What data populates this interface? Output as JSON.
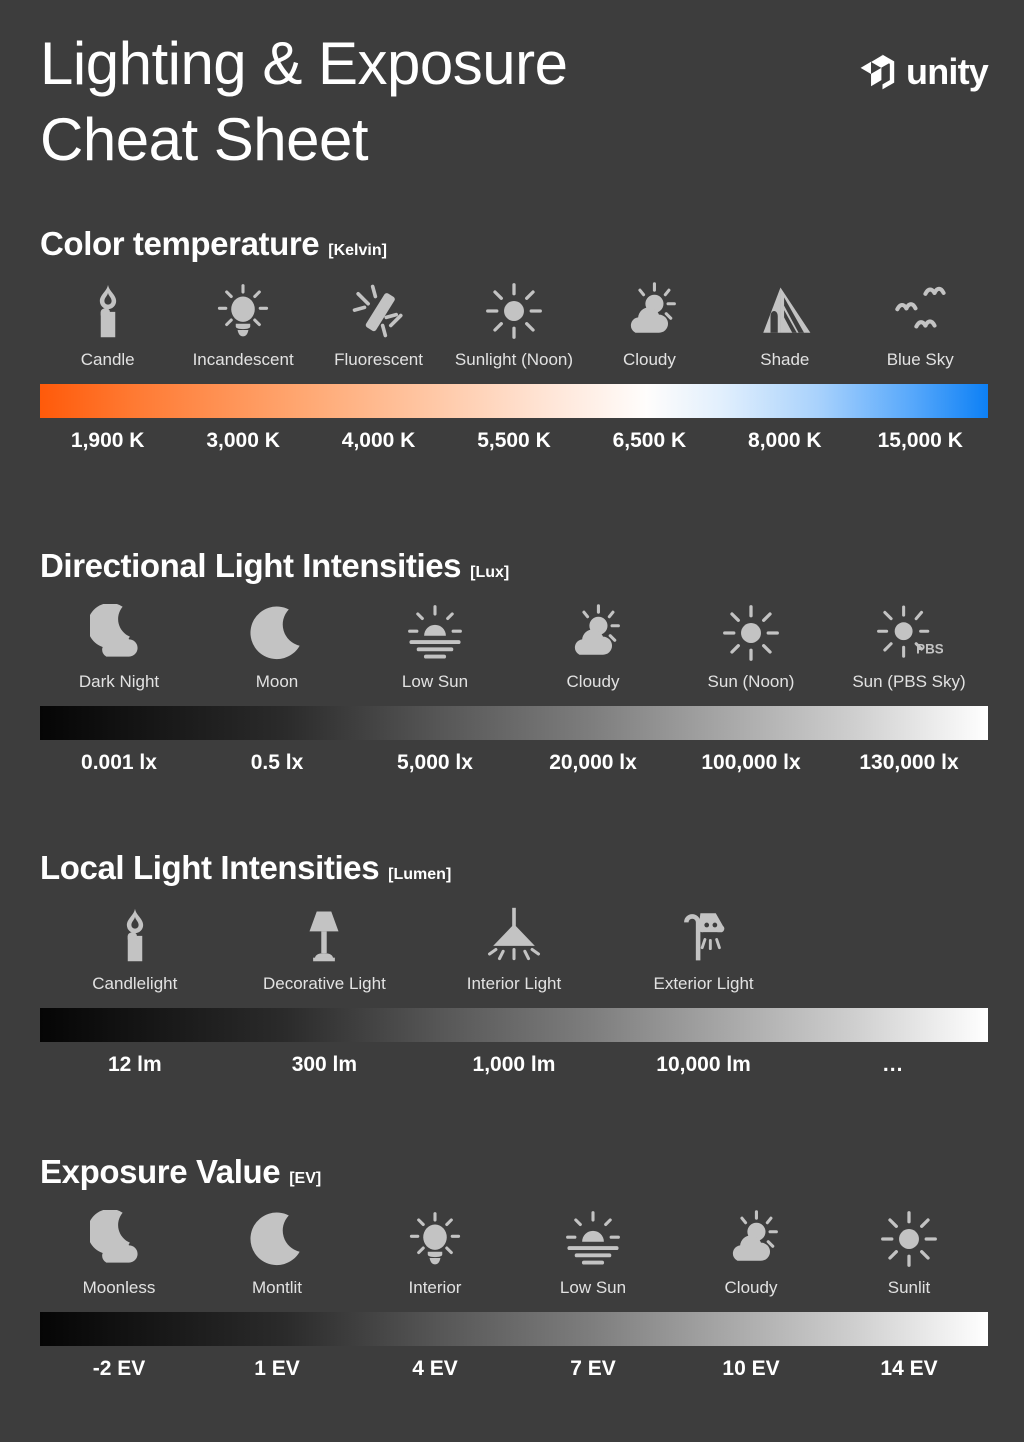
{
  "header": {
    "title": "Lighting & Exposure\nCheat Sheet",
    "brand": "unity",
    "logo_icon": "unity-cube-icon"
  },
  "colors": {
    "background": "#3d3d3d",
    "text": "#ffffff",
    "icon": "#c3c3c3",
    "kelvin_warm": "#ff5a0a",
    "kelvin_cool": "#0d80f5",
    "gray_dark": "#050505",
    "gray_light": "#ffffff"
  },
  "sections": [
    {
      "id": "color-temperature",
      "title": "Color temperature",
      "unit": "[Kelvin]",
      "bar_style": "kelvin",
      "items": [
        {
          "icon": "candle-icon",
          "label": "Candle",
          "value": "1,900 K"
        },
        {
          "icon": "incandescent-bulb-icon",
          "label": "Incandescent",
          "value": "3,000 K"
        },
        {
          "icon": "fluorescent-tube-icon",
          "label": "Fluorescent",
          "value": "4,000 K"
        },
        {
          "icon": "sun-icon",
          "label": "Sunlight (Noon)",
          "value": "5,500 K"
        },
        {
          "icon": "sun-cloud-icon",
          "label": "Cloudy",
          "value": "6,500 K"
        },
        {
          "icon": "shade-house-icon",
          "label": "Shade",
          "value": "8,000 K"
        },
        {
          "icon": "birds-sky-icon",
          "label": "Blue Sky",
          "value": "15,000 K"
        }
      ]
    },
    {
      "id": "directional-light-intensities",
      "title": "Directional Light Intensities",
      "unit": "[Lux]",
      "bar_style": "gray",
      "items": [
        {
          "icon": "moon-cloud-icon",
          "label": "Dark Night",
          "value": "0.001 lx"
        },
        {
          "icon": "moon-icon",
          "label": "Moon",
          "value": "0.5 lx"
        },
        {
          "icon": "low-sun-icon",
          "label": "Low Sun",
          "value": "5,000 lx"
        },
        {
          "icon": "sun-cloud-icon",
          "label": "Cloudy",
          "value": "20,000 lx"
        },
        {
          "icon": "sun-icon",
          "label": "Sun (Noon)",
          "value": "100,000 lx"
        },
        {
          "icon": "sun-pbs-icon",
          "label": "Sun (PBS Sky)",
          "value": "130,000 lx"
        }
      ]
    },
    {
      "id": "local-light-intensities",
      "title": "Local Light Intensities",
      "unit": "[Lumen]",
      "bar_style": "gray",
      "items": [
        {
          "icon": "candle-icon",
          "label": "Candlelight",
          "value": "12 lm"
        },
        {
          "icon": "table-lamp-icon",
          "label": "Decorative Light",
          "value": "300 lm"
        },
        {
          "icon": "pendant-lamp-icon",
          "label": "Interior Light",
          "value": "1,000 lm"
        },
        {
          "icon": "street-lamp-icon",
          "label": "Exterior Light",
          "value": "10,000 lm"
        },
        {
          "icon": "",
          "label": "",
          "value": "..."
        }
      ]
    },
    {
      "id": "exposure-value",
      "title": "Exposure Value",
      "unit": "[EV]",
      "bar_style": "gray",
      "items": [
        {
          "icon": "moon-cloud-icon",
          "label": "Moonless",
          "value": "-2 EV"
        },
        {
          "icon": "moon-icon",
          "label": "Montlit",
          "value": "1 EV"
        },
        {
          "icon": "incandescent-bulb-icon",
          "label": "Interior",
          "value": "4 EV"
        },
        {
          "icon": "low-sun-icon",
          "label": "Low Sun",
          "value": "7 EV"
        },
        {
          "icon": "sun-cloud-icon",
          "label": "Cloudy",
          "value": "10 EV"
        },
        {
          "icon": "sun-icon",
          "label": "Sunlit",
          "value": "14 EV"
        }
      ]
    }
  ]
}
